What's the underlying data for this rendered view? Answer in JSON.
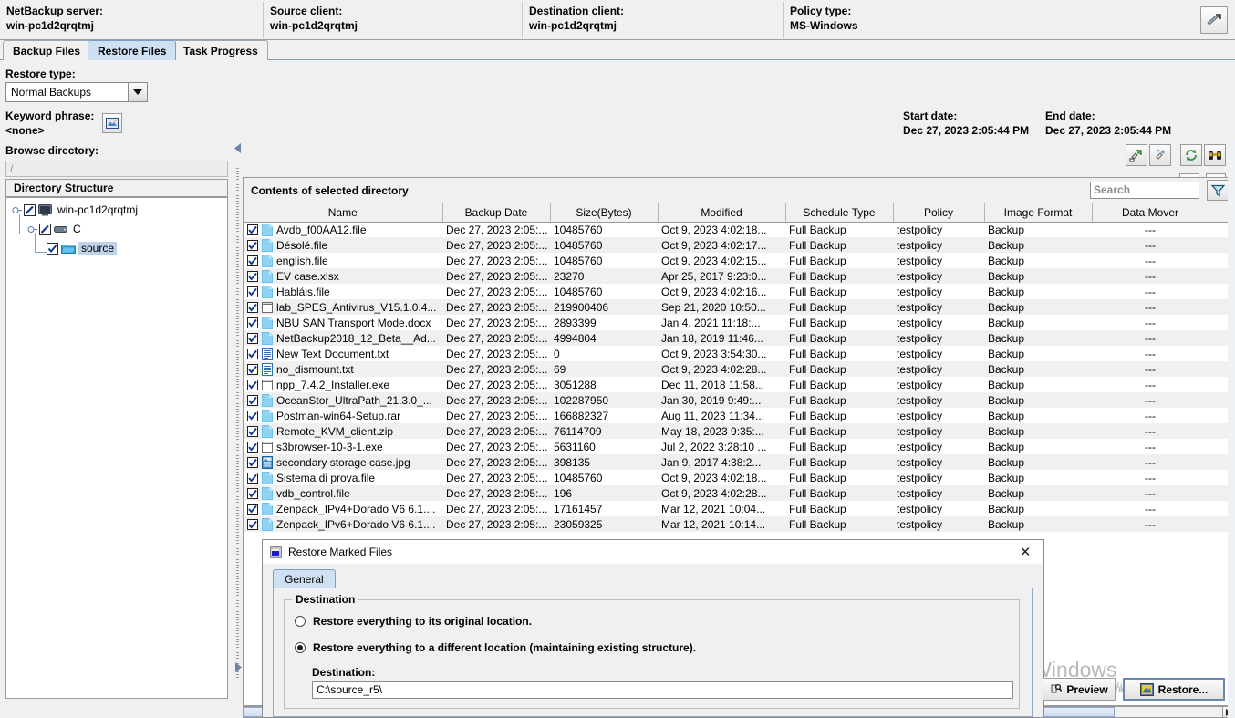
{
  "header": {
    "fields": [
      {
        "label": "NetBackup server:",
        "value": "win-pc1d2qrqtmj"
      },
      {
        "label": "Source client:",
        "value": "win-pc1d2qrqtmj"
      },
      {
        "label": "Destination client:",
        "value": "win-pc1d2qrqtmj"
      },
      {
        "label": "Policy type:",
        "value": "MS-Windows"
      }
    ]
  },
  "tabs": [
    {
      "label": "Backup Files",
      "active": false
    },
    {
      "label": "Restore Files",
      "active": true
    },
    {
      "label": "Task Progress",
      "active": false
    }
  ],
  "restore_panel": {
    "restore_type_label": "Restore type:",
    "restore_type_value": "Normal Backups",
    "keyword_label": "Keyword phrase:",
    "keyword_value": "<none>",
    "start_date_label": "Start date:",
    "start_date_value": "Dec 27, 2023 2:05:44 PM",
    "end_date_label": "End date:",
    "end_date_value": "Dec 27, 2023 2:05:44 PM"
  },
  "browse": {
    "label": "Browse directory:",
    "path_value": "/",
    "structure_header": "Directory Structure",
    "tree": [
      {
        "label": "win-pc1d2qrqtmj",
        "icon": "computer-icon",
        "checked": "partial",
        "selected": false
      },
      {
        "label": "C",
        "icon": "drive-icon",
        "checked": "partial",
        "selected": false
      },
      {
        "label": "source",
        "icon": "folder-icon",
        "checked": "checked",
        "selected": true
      }
    ]
  },
  "contents": {
    "title": "Contents of selected directory",
    "search_placeholder": "Search",
    "columns": [
      "Name",
      "Backup Date",
      "Size(Bytes)",
      "Modified",
      "Schedule Type",
      "Policy",
      "Image Format",
      "Data Mover",
      ""
    ],
    "rows": [
      {
        "name": "Avdb_f00AA12.file",
        "icon": "file-icon",
        "backup_date": "Dec 27, 2023 2:05:...",
        "size": "10485760",
        "modified": "Oct 9, 2023 4:02:18...",
        "schedule": "Full Backup",
        "policy": "testpolicy",
        "image_format": "Backup",
        "data_mover": "---",
        "extra": "---"
      },
      {
        "name": "Désolé.file",
        "icon": "file-icon",
        "backup_date": "Dec 27, 2023 2:05:...",
        "size": "10485760",
        "modified": "Oct 9, 2023 4:02:17...",
        "schedule": "Full Backup",
        "policy": "testpolicy",
        "image_format": "Backup",
        "data_mover": "---",
        "extra": "---"
      },
      {
        "name": "english.file",
        "icon": "file-icon",
        "backup_date": "Dec 27, 2023 2:05:...",
        "size": "10485760",
        "modified": "Oct 9, 2023 4:02:15...",
        "schedule": "Full Backup",
        "policy": "testpolicy",
        "image_format": "Backup",
        "data_mover": "---",
        "extra": "---"
      },
      {
        "name": "EV case.xlsx",
        "icon": "file-icon",
        "backup_date": "Dec 27, 2023 2:05:...",
        "size": "23270",
        "modified": "Apr 25, 2017 9:23:0...",
        "schedule": "Full Backup",
        "policy": "testpolicy",
        "image_format": "Backup",
        "data_mover": "---",
        "extra": "---"
      },
      {
        "name": "Habláis.file",
        "icon": "file-icon",
        "backup_date": "Dec 27, 2023 2:05:...",
        "size": "10485760",
        "modified": "Oct 9, 2023 4:02:16...",
        "schedule": "Full Backup",
        "policy": "testpolicy",
        "image_format": "Backup",
        "data_mover": "---",
        "extra": "---"
      },
      {
        "name": "lab_SPES_Antivirus_V15.1.0.4...",
        "icon": "exe-icon",
        "backup_date": "Dec 27, 2023 2:05:...",
        "size": "219900406",
        "modified": "Sep 21, 2020 10:50...",
        "schedule": "Full Backup",
        "policy": "testpolicy",
        "image_format": "Backup",
        "data_mover": "---",
        "extra": "---"
      },
      {
        "name": "NBU SAN Transport Mode.docx",
        "icon": "file-icon",
        "backup_date": "Dec 27, 2023 2:05:...",
        "size": "2893399",
        "modified": "Jan 4, 2021 11:18:...",
        "schedule": "Full Backup",
        "policy": "testpolicy",
        "image_format": "Backup",
        "data_mover": "---",
        "extra": "---"
      },
      {
        "name": "NetBackup2018_12_Beta__Ad...",
        "icon": "file-icon",
        "backup_date": "Dec 27, 2023 2:05:...",
        "size": "4994804",
        "modified": "Jan 18, 2019 11:46...",
        "schedule": "Full Backup",
        "policy": "testpolicy",
        "image_format": "Backup",
        "data_mover": "---",
        "extra": "---"
      },
      {
        "name": "New Text Document.txt",
        "icon": "text-icon",
        "backup_date": "Dec 27, 2023 2:05:...",
        "size": "0",
        "modified": "Oct 9, 2023 3:54:30...",
        "schedule": "Full Backup",
        "policy": "testpolicy",
        "image_format": "Backup",
        "data_mover": "---",
        "extra": "---"
      },
      {
        "name": "no_dismount.txt",
        "icon": "text-icon",
        "backup_date": "Dec 27, 2023 2:05:...",
        "size": "69",
        "modified": "Oct 9, 2023 4:02:28...",
        "schedule": "Full Backup",
        "policy": "testpolicy",
        "image_format": "Backup",
        "data_mover": "---",
        "extra": "---"
      },
      {
        "name": "npp_7.4.2_Installer.exe",
        "icon": "exe-icon",
        "backup_date": "Dec 27, 2023 2:05:...",
        "size": "3051288",
        "modified": "Dec 11, 2018 11:58...",
        "schedule": "Full Backup",
        "policy": "testpolicy",
        "image_format": "Backup",
        "data_mover": "---",
        "extra": "---"
      },
      {
        "name": "OceanStor_UltraPath_21.3.0_...",
        "icon": "file-icon",
        "backup_date": "Dec 27, 2023 2:05:...",
        "size": "102287950",
        "modified": "Jan 30, 2019 9:49:...",
        "schedule": "Full Backup",
        "policy": "testpolicy",
        "image_format": "Backup",
        "data_mover": "---",
        "extra": "---"
      },
      {
        "name": "Postman-win64-Setup.rar",
        "icon": "file-icon",
        "backup_date": "Dec 27, 2023 2:05:...",
        "size": "166882327",
        "modified": "Aug 11, 2023 11:34...",
        "schedule": "Full Backup",
        "policy": "testpolicy",
        "image_format": "Backup",
        "data_mover": "---",
        "extra": "---"
      },
      {
        "name": "Remote_KVM_client.zip",
        "icon": "file-icon",
        "backup_date": "Dec 27, 2023 2:05:...",
        "size": "76114709",
        "modified": "May 18, 2023 9:35:...",
        "schedule": "Full Backup",
        "policy": "testpolicy",
        "image_format": "Backup",
        "data_mover": "---",
        "extra": "---"
      },
      {
        "name": "s3browser-10-3-1.exe",
        "icon": "exe-icon",
        "backup_date": "Dec 27, 2023 2:05:...",
        "size": "5631160",
        "modified": "Jul 2, 2022 3:28:10 ...",
        "schedule": "Full Backup",
        "policy": "testpolicy",
        "image_format": "Backup",
        "data_mover": "---",
        "extra": "---"
      },
      {
        "name": "secondary storage case.jpg",
        "icon": "image-icon",
        "backup_date": "Dec 27, 2023 2:05:...",
        "size": "398135",
        "modified": "Jan 9, 2017 4:38:2...",
        "schedule": "Full Backup",
        "policy": "testpolicy",
        "image_format": "Backup",
        "data_mover": "---",
        "extra": "---"
      },
      {
        "name": "Sistema di prova.file",
        "icon": "file-icon",
        "backup_date": "Dec 27, 2023 2:05:...",
        "size": "10485760",
        "modified": "Oct 9, 2023 4:02:18...",
        "schedule": "Full Backup",
        "policy": "testpolicy",
        "image_format": "Backup",
        "data_mover": "---",
        "extra": "---"
      },
      {
        "name": "vdb_control.file",
        "icon": "file-icon",
        "backup_date": "Dec 27, 2023 2:05:...",
        "size": "196",
        "modified": "Oct 9, 2023 4:02:28...",
        "schedule": "Full Backup",
        "policy": "testpolicy",
        "image_format": "Backup",
        "data_mover": "---",
        "extra": "---"
      },
      {
        "name": "Zenpack_IPv4+Dorado V6 6.1....",
        "icon": "file-icon",
        "backup_date": "Dec 27, 2023 2:05:...",
        "size": "17161457",
        "modified": "Mar 12, 2021 10:04...",
        "schedule": "Full Backup",
        "policy": "testpolicy",
        "image_format": "Backup",
        "data_mover": "---",
        "extra": "---"
      },
      {
        "name": "Zenpack_IPv6+Dorado V6 6.1....",
        "icon": "file-icon",
        "backup_date": "Dec 27, 2023 2:05:...",
        "size": "23059325",
        "modified": "Mar 12, 2021 10:14...",
        "schedule": "Full Backup",
        "policy": "testpolicy",
        "image_format": "Backup",
        "data_mover": "---",
        "extra": "---"
      }
    ]
  },
  "dialog": {
    "title": "Restore Marked Files",
    "tab_general": "General",
    "group_title": "Destination",
    "option_original": "Restore everything to its original location.",
    "option_different": "Restore everything to a different location (maintaining existing structure).",
    "destination_label": "Destination:",
    "destination_value": "C:\\source_r5\\",
    "preview_button": "Preview",
    "restore_button": "Restore..."
  },
  "watermark": {
    "line1": "Activate Windows",
    "line2": "Go to Settings to activate Windows.",
    "overlay": "Activate Windows"
  },
  "colors": {
    "accent": "#cfe0f2",
    "border": "#9a9a9a",
    "panel": "#f0f0f0",
    "selection": "#bed2e8"
  }
}
